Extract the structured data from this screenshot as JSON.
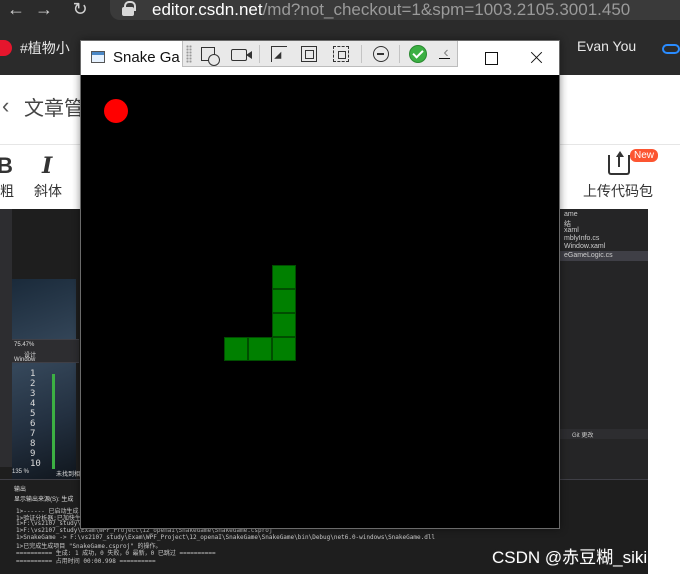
{
  "browser": {
    "url_host": "editor.csdn.net",
    "url_rest": "/md?not_checkout=1&spm=1003.2105.3001.450",
    "back_glyph": "←",
    "forward_glyph": "→",
    "reload_glyph": "↻",
    "bookmarks": [
      "#植物小",
      "Evan You"
    ]
  },
  "page": {
    "title": "文章管",
    "toolbar": [
      {
        "glyph": "B",
        "label": "粗"
      },
      {
        "glyph": "I",
        "label": "斜体"
      }
    ],
    "upload_label": "上传代码包",
    "new_badge": "New",
    "watermark": "CSDN @赤豆糊_siki"
  },
  "ide": {
    "solution_items": [
      "ame",
      "结",
      "xaml",
      "mblyInfo.cs",
      "Window.xaml",
      "eGameLogic.cs"
    ],
    "tabs_label": "Git 更改",
    "zoom": "75.47%",
    "view_label": "设计",
    "window_label": "Window",
    "line_numbers": [
      "1",
      "2",
      "3",
      "4",
      "5",
      "6",
      "7",
      "8",
      "9",
      "10"
    ],
    "zoom2": "135 %",
    "status_label": "未找到相关",
    "output_title": "输出",
    "output_source": "显示输出来源(S): 生成",
    "output_lines": [
      "1>------ 已启动生成: 项目",
      "1>验证分析器:已加快生成",
      "1>F:\\vs2107_study\\Exam",
      "1>F:\\vs2107_study\\Exam\\WPF_Project\\12_openaI\\SnakeGame\\SnakeGame.csproj",
      "1>SnakeGame -> F:\\vs2107_study\\Exam\\WPF_Project\\12_openaI\\SnakeGame\\SnakeGame\\bin\\Debug\\net6.0-windows\\SnakeGame.dll",
      "1>已完成生成项目 \"SnakeGame.csproj\" 的操作。",
      "========== 生成: 1 成功，0 失败，0 最新，0 已跳过 ==========",
      "========== 占用时间 00:00.998 =========="
    ]
  },
  "game_window": {
    "title": "Snake Ga",
    "collapse_glyph": "‹",
    "colors": {
      "board": "#000000",
      "snake": "#008000",
      "food": "#ff0000"
    },
    "snake_segments": [
      {
        "col": 8,
        "row": 8
      },
      {
        "col": 8,
        "row": 9
      },
      {
        "col": 8,
        "row": 10
      },
      {
        "col": 8,
        "row": 11
      },
      {
        "col": 7,
        "row": 11
      },
      {
        "col": 6,
        "row": 11
      }
    ],
    "food_cell": {
      "col": 1,
      "row": 1
    }
  }
}
